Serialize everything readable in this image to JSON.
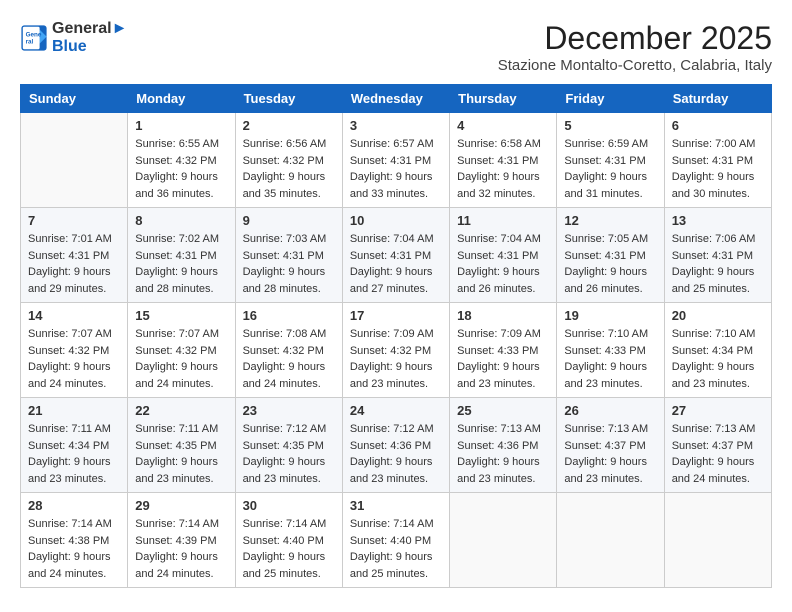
{
  "header": {
    "logo_line1": "General",
    "logo_line2": "Blue",
    "month": "December 2025",
    "location": "Stazione Montalto-Coretto, Calabria, Italy"
  },
  "weekdays": [
    "Sunday",
    "Monday",
    "Tuesday",
    "Wednesday",
    "Thursday",
    "Friday",
    "Saturday"
  ],
  "weeks": [
    [
      {
        "day": "",
        "info": ""
      },
      {
        "day": "1",
        "info": "Sunrise: 6:55 AM\nSunset: 4:32 PM\nDaylight: 9 hours\nand 36 minutes."
      },
      {
        "day": "2",
        "info": "Sunrise: 6:56 AM\nSunset: 4:32 PM\nDaylight: 9 hours\nand 35 minutes."
      },
      {
        "day": "3",
        "info": "Sunrise: 6:57 AM\nSunset: 4:31 PM\nDaylight: 9 hours\nand 33 minutes."
      },
      {
        "day": "4",
        "info": "Sunrise: 6:58 AM\nSunset: 4:31 PM\nDaylight: 9 hours\nand 32 minutes."
      },
      {
        "day": "5",
        "info": "Sunrise: 6:59 AM\nSunset: 4:31 PM\nDaylight: 9 hours\nand 31 minutes."
      },
      {
        "day": "6",
        "info": "Sunrise: 7:00 AM\nSunset: 4:31 PM\nDaylight: 9 hours\nand 30 minutes."
      }
    ],
    [
      {
        "day": "7",
        "info": "Sunrise: 7:01 AM\nSunset: 4:31 PM\nDaylight: 9 hours\nand 29 minutes."
      },
      {
        "day": "8",
        "info": "Sunrise: 7:02 AM\nSunset: 4:31 PM\nDaylight: 9 hours\nand 28 minutes."
      },
      {
        "day": "9",
        "info": "Sunrise: 7:03 AM\nSunset: 4:31 PM\nDaylight: 9 hours\nand 28 minutes."
      },
      {
        "day": "10",
        "info": "Sunrise: 7:04 AM\nSunset: 4:31 PM\nDaylight: 9 hours\nand 27 minutes."
      },
      {
        "day": "11",
        "info": "Sunrise: 7:04 AM\nSunset: 4:31 PM\nDaylight: 9 hours\nand 26 minutes."
      },
      {
        "day": "12",
        "info": "Sunrise: 7:05 AM\nSunset: 4:31 PM\nDaylight: 9 hours\nand 26 minutes."
      },
      {
        "day": "13",
        "info": "Sunrise: 7:06 AM\nSunset: 4:31 PM\nDaylight: 9 hours\nand 25 minutes."
      }
    ],
    [
      {
        "day": "14",
        "info": "Sunrise: 7:07 AM\nSunset: 4:32 PM\nDaylight: 9 hours\nand 24 minutes."
      },
      {
        "day": "15",
        "info": "Sunrise: 7:07 AM\nSunset: 4:32 PM\nDaylight: 9 hours\nand 24 minutes."
      },
      {
        "day": "16",
        "info": "Sunrise: 7:08 AM\nSunset: 4:32 PM\nDaylight: 9 hours\nand 24 minutes."
      },
      {
        "day": "17",
        "info": "Sunrise: 7:09 AM\nSunset: 4:32 PM\nDaylight: 9 hours\nand 23 minutes."
      },
      {
        "day": "18",
        "info": "Sunrise: 7:09 AM\nSunset: 4:33 PM\nDaylight: 9 hours\nand 23 minutes."
      },
      {
        "day": "19",
        "info": "Sunrise: 7:10 AM\nSunset: 4:33 PM\nDaylight: 9 hours\nand 23 minutes."
      },
      {
        "day": "20",
        "info": "Sunrise: 7:10 AM\nSunset: 4:34 PM\nDaylight: 9 hours\nand 23 minutes."
      }
    ],
    [
      {
        "day": "21",
        "info": "Sunrise: 7:11 AM\nSunset: 4:34 PM\nDaylight: 9 hours\nand 23 minutes."
      },
      {
        "day": "22",
        "info": "Sunrise: 7:11 AM\nSunset: 4:35 PM\nDaylight: 9 hours\nand 23 minutes."
      },
      {
        "day": "23",
        "info": "Sunrise: 7:12 AM\nSunset: 4:35 PM\nDaylight: 9 hours\nand 23 minutes."
      },
      {
        "day": "24",
        "info": "Sunrise: 7:12 AM\nSunset: 4:36 PM\nDaylight: 9 hours\nand 23 minutes."
      },
      {
        "day": "25",
        "info": "Sunrise: 7:13 AM\nSunset: 4:36 PM\nDaylight: 9 hours\nand 23 minutes."
      },
      {
        "day": "26",
        "info": "Sunrise: 7:13 AM\nSunset: 4:37 PM\nDaylight: 9 hours\nand 23 minutes."
      },
      {
        "day": "27",
        "info": "Sunrise: 7:13 AM\nSunset: 4:37 PM\nDaylight: 9 hours\nand 24 minutes."
      }
    ],
    [
      {
        "day": "28",
        "info": "Sunrise: 7:14 AM\nSunset: 4:38 PM\nDaylight: 9 hours\nand 24 minutes."
      },
      {
        "day": "29",
        "info": "Sunrise: 7:14 AM\nSunset: 4:39 PM\nDaylight: 9 hours\nand 24 minutes."
      },
      {
        "day": "30",
        "info": "Sunrise: 7:14 AM\nSunset: 4:40 PM\nDaylight: 9 hours\nand 25 minutes."
      },
      {
        "day": "31",
        "info": "Sunrise: 7:14 AM\nSunset: 4:40 PM\nDaylight: 9 hours\nand 25 minutes."
      },
      {
        "day": "",
        "info": ""
      },
      {
        "day": "",
        "info": ""
      },
      {
        "day": "",
        "info": ""
      }
    ]
  ]
}
